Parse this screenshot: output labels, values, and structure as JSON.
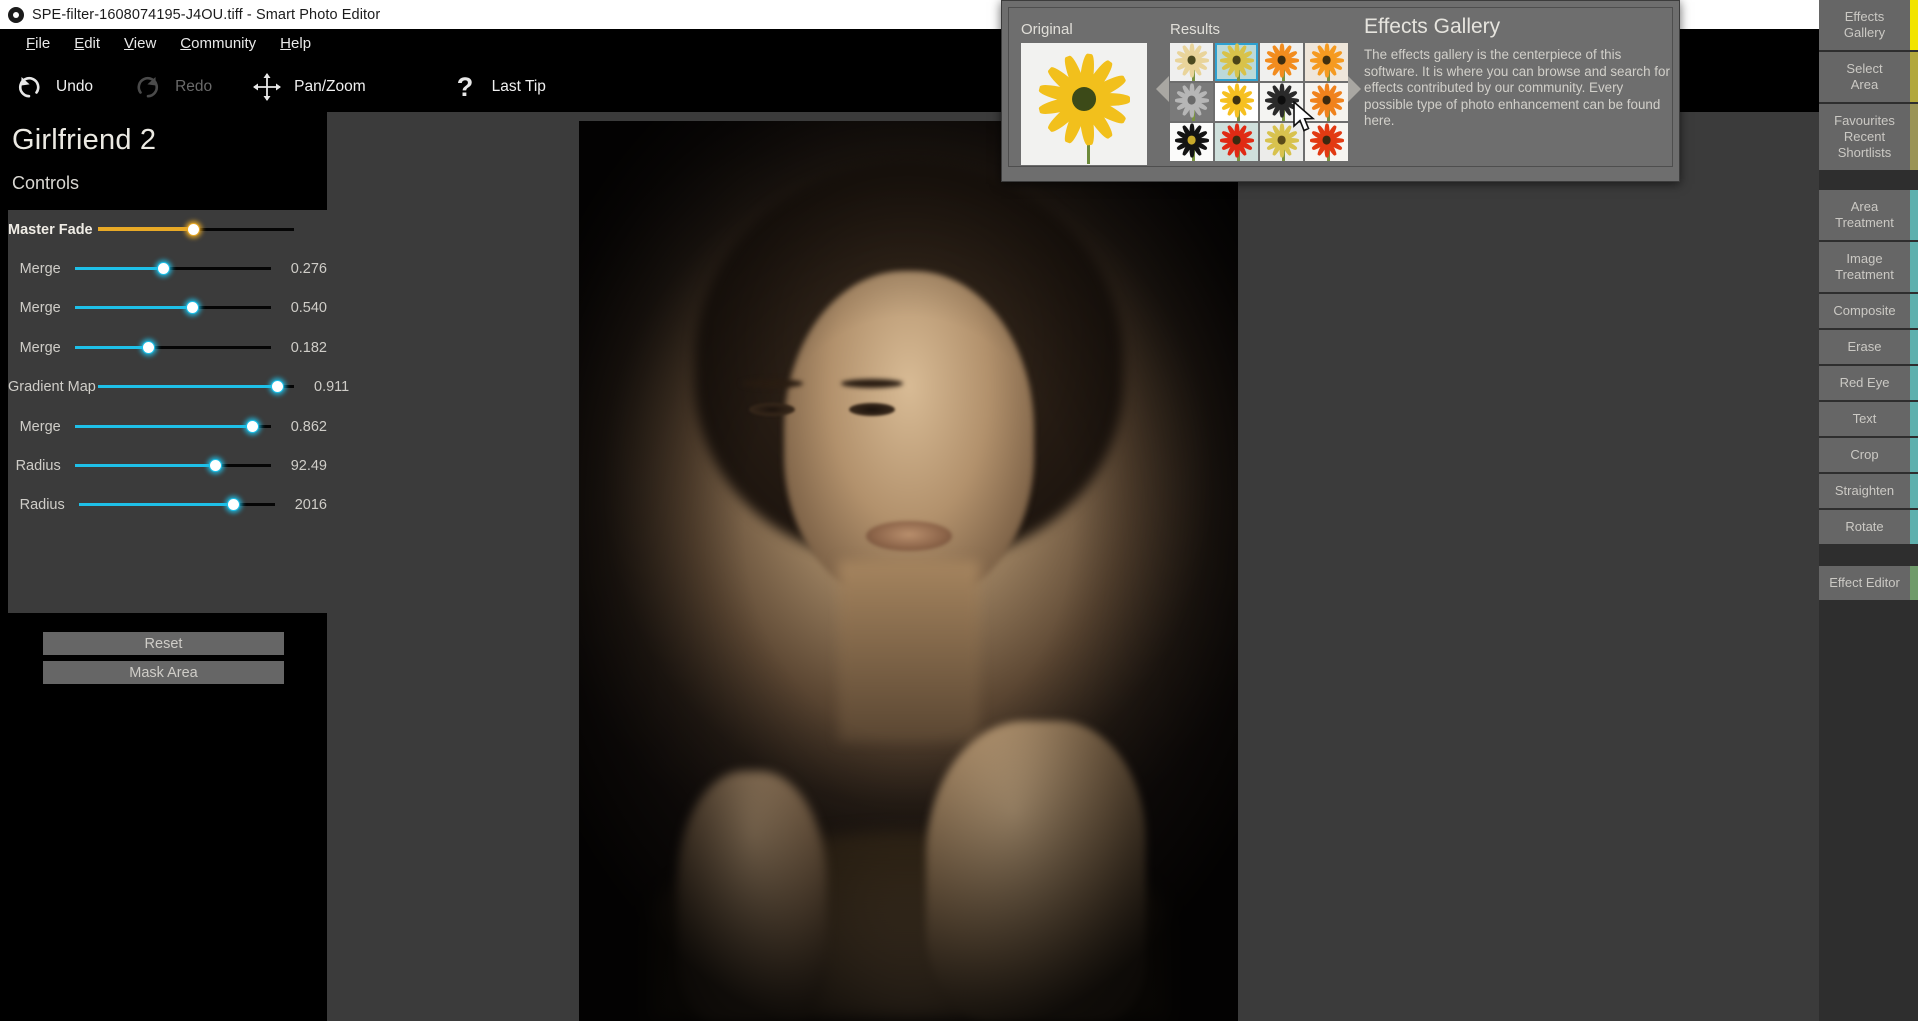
{
  "window": {
    "title": "SPE-filter-1608074195-J4OU.tiff - Smart Photo Editor",
    "app_icon": "aperture-icon",
    "controls": {
      "restore_label": "❐",
      "close_label": "✕"
    }
  },
  "menubar": {
    "items": [
      {
        "label": "File",
        "mnemonic": "F"
      },
      {
        "label": "Edit",
        "mnemonic": "E"
      },
      {
        "label": "View",
        "mnemonic": "V"
      },
      {
        "label": "Community",
        "mnemonic": "C"
      },
      {
        "label": "Help",
        "mnemonic": "H"
      }
    ]
  },
  "toolbar": {
    "items": [
      {
        "label": "Undo",
        "icon": "undo-icon",
        "enabled": true
      },
      {
        "label": "Redo",
        "icon": "redo-icon",
        "enabled": false
      },
      {
        "label": "Pan/Zoom",
        "icon": "pan-zoom-icon",
        "enabled": true
      },
      {
        "label": "Last Tip",
        "icon": "question-mark-icon",
        "enabled": true
      }
    ]
  },
  "left_panel": {
    "effect_name": "Girlfriend 2",
    "controls_heading": "Controls",
    "sliders": [
      {
        "label": "Master Fade",
        "value": "",
        "percent": 49.0,
        "accent": "#e8a926",
        "master": true
      },
      {
        "label": "Merge",
        "value": "0.276",
        "percent": 45.5,
        "accent": "#1ec0e8",
        "master": false
      },
      {
        "label": "Merge",
        "value": "0.540",
        "percent": 60.5,
        "accent": "#1ec0e8",
        "master": false
      },
      {
        "label": "Merge",
        "value": "0.182",
        "percent": 38.0,
        "accent": "#1ec0e8",
        "master": false
      },
      {
        "label": "Gradient Map",
        "value": "0.911",
        "percent": 92.0,
        "accent": "#1ec0e8",
        "master": false
      },
      {
        "label": "Merge",
        "value": "0.862",
        "percent": 91.0,
        "accent": "#1ec0e8",
        "master": false
      },
      {
        "label": "Radius",
        "value": "92.49",
        "percent": 72.0,
        "accent": "#1ec0e8",
        "master": false
      },
      {
        "label": "Radius",
        "value": "2016",
        "percent": 79.0,
        "accent": "#1ec0e8",
        "master": false
      }
    ],
    "buttons": {
      "reset": "Reset",
      "mask_area": "Mask Area"
    }
  },
  "right_sidebar": {
    "groups": [
      {
        "items": [
          {
            "label": "Effects\nGallery",
            "accent": "#f2e400"
          },
          {
            "label": "Select\nArea",
            "accent": "#b2a83c"
          },
          {
            "label": "Favourites\nRecent\nShortlists",
            "accent": "#9a9456"
          }
        ]
      },
      {
        "items": [
          {
            "label": "Area\nTreatment",
            "accent": "#5fb0ad"
          },
          {
            "label": "Image\nTreatment",
            "accent": "#5fb0ad"
          },
          {
            "label": "Composite",
            "accent": "#5fb0ad"
          },
          {
            "label": "Erase",
            "accent": "#5fb0ad"
          },
          {
            "label": "Red Eye",
            "accent": "#5fb0ad"
          },
          {
            "label": "Text",
            "accent": "#5fb0ad"
          },
          {
            "label": "Crop",
            "accent": "#5fb0ad"
          },
          {
            "label": "Straighten",
            "accent": "#5fb0ad"
          },
          {
            "label": "Rotate",
            "accent": "#5fb0ad"
          }
        ]
      },
      {
        "items": [
          {
            "label": "Effect Editor",
            "accent": "#6f9a6a"
          }
        ]
      }
    ]
  },
  "gallery_popup": {
    "original_label": "Original",
    "results_label": "Results",
    "title": "Effects Gallery",
    "description": "The effects gallery is the centerpiece of this software. It is where you can browse and search for effects contributed by our community.  Every possible type of photo enhancement can be found here.",
    "prev_arrow": "left-triangle-icon",
    "next_arrow": "right-triangle-icon",
    "original_thumbnail": "yellow-rudbeckia-flower",
    "results": [
      {
        "name": "pale-wash-flower",
        "petal": "#e9d49a",
        "center": "#4c4a1f",
        "bg": "#efefee",
        "selected": false
      },
      {
        "name": "teal-bg-flower",
        "petal": "#d8c24a",
        "center": "#4a4418",
        "bg": "#bcd9d9",
        "selected": true
      },
      {
        "name": "orange-flower",
        "petal": "#f28c1e",
        "center": "#3a2c12",
        "bg": "#f0f0ee",
        "selected": false
      },
      {
        "name": "glow-orange-flower",
        "petal": "#f59a20",
        "center": "#40300f",
        "bg": "#efe6da",
        "selected": false
      },
      {
        "name": "grayscale-soft-flower",
        "petal": "#b6b6b6",
        "center": "#6a6a6a",
        "bg": "#7a7a7a",
        "selected": false
      },
      {
        "name": "bright-yellow-flower",
        "petal": "#f6c021",
        "center": "#3e3211",
        "bg": "#ffffff",
        "selected": false
      },
      {
        "name": "high-contrast-flower",
        "petal": "#2a2a2a",
        "center": "#0d0d0d",
        "bg": "#f4f4f2",
        "selected": false
      },
      {
        "name": "warm-orange-flower",
        "petal": "#f0821c",
        "center": "#3b2a10",
        "bg": "#f6f3ee",
        "selected": false
      },
      {
        "name": "black-silhouette-flower",
        "petal": "#131313",
        "center": "#c8a92a",
        "bg": "#fbfbfa",
        "selected": false
      },
      {
        "name": "red-flower",
        "petal": "#e02a14",
        "center": "#3a2a10",
        "bg": "#cfe0dc",
        "selected": false
      },
      {
        "name": "muted-sketch-flower",
        "petal": "#d8c24e",
        "center": "#5a4a18",
        "bg": "#ececea",
        "selected": false
      },
      {
        "name": "crimson-flower",
        "petal": "#e23a12",
        "center": "#3a2810",
        "bg": "#f7f5f1",
        "selected": false
      }
    ]
  },
  "canvas": {
    "image_name": "portrait-photo-girlfriend-2"
  }
}
